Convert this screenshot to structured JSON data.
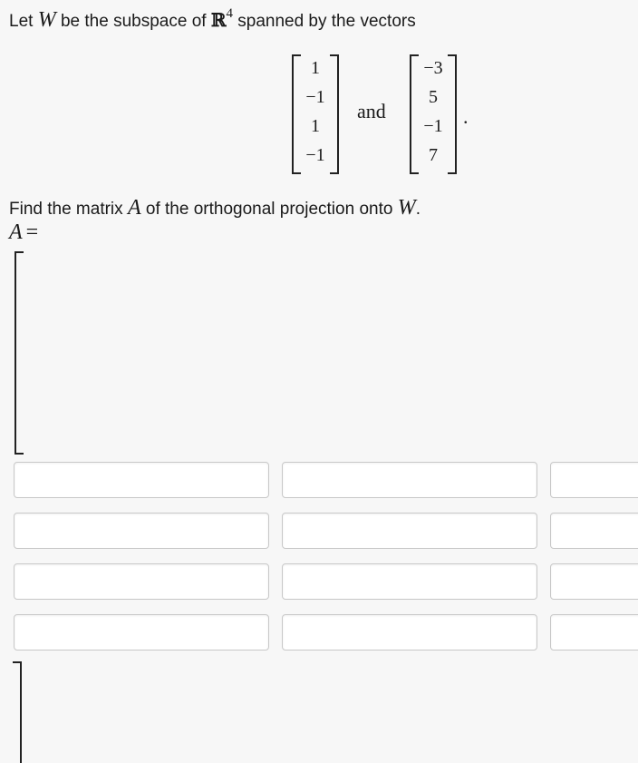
{
  "question": {
    "intro_prefix": "Let",
    "intro_var": "W",
    "intro_mid": "be the subspace of",
    "intro_space": "ℝ",
    "intro_exp": "4",
    "intro_suffix": "spanned by the vectors",
    "vector1": [
      "1",
      "−1",
      "1",
      "−1"
    ],
    "vector2": [
      "−3",
      "5",
      "−1",
      "7"
    ],
    "and_word": "and",
    "period": ".",
    "find_prefix": "Find the matrix",
    "find_var": "A",
    "find_mid": "of the orthogonal projection onto",
    "find_target": "W",
    "find_end": ".",
    "answer_var": "A",
    "answer_eq": "="
  },
  "answer_grid": {
    "rows": 4,
    "visible_columns": 3,
    "cells": [
      [
        "",
        "",
        ""
      ],
      [
        "",
        "",
        ""
      ],
      [
        "",
        "",
        ""
      ],
      [
        "",
        "",
        ""
      ]
    ]
  }
}
